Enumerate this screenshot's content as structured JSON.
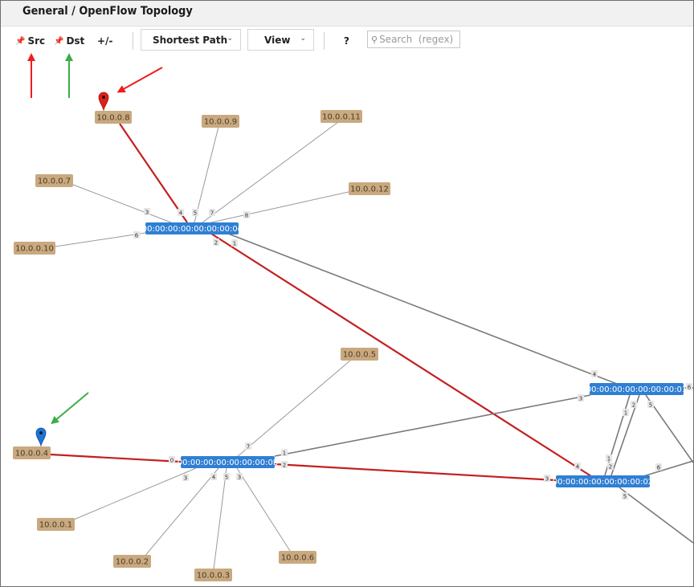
{
  "window": {
    "title": "General / OpenFlow Topology"
  },
  "toolbar": {
    "src_label": "Src",
    "dst_label": "Dst",
    "zoom_label": "+/-",
    "shortest_path_label": "Shortest Path",
    "view_label": "View",
    "help_label": "?",
    "search_placeholder": "Search  (regex)",
    "search_value": ""
  },
  "topology": {
    "switches": [
      {
        "id": "sw0c",
        "label": "00:00:00:00:00:00:00:0c"
      },
      {
        "id": "sw01",
        "label": "00:00:00:00:00:00:00:01"
      },
      {
        "id": "sw0b",
        "label": "00:00:00:00:00:00:00:0b"
      },
      {
        "id": "sw02",
        "label": "00:00:00:00:00:00:00:02"
      }
    ],
    "hosts": [
      {
        "id": "h8",
        "label": "10.0.0.8"
      },
      {
        "id": "h9",
        "label": "10.0.0.9"
      },
      {
        "id": "h11",
        "label": "10.0.0.11"
      },
      {
        "id": "h7",
        "label": "10.0.0.7"
      },
      {
        "id": "h12",
        "label": "10.0.0.12"
      },
      {
        "id": "h10",
        "label": "10.0.0.10"
      },
      {
        "id": "h5",
        "label": "10.0.0.5"
      },
      {
        "id": "h4",
        "label": "10.0.0.4"
      },
      {
        "id": "h1",
        "label": "10.0.0.1"
      },
      {
        "id": "h2",
        "label": "10.0.0.2"
      },
      {
        "id": "h3",
        "label": "10.0.0.3"
      },
      {
        "id": "h6",
        "label": "10.0.0.6"
      }
    ],
    "links": [
      {
        "from": "h8",
        "to": "sw0c",
        "port": "4",
        "path": true
      },
      {
        "from": "h9",
        "to": "sw0c",
        "port": "5",
        "path": false
      },
      {
        "from": "h11",
        "to": "sw0c",
        "port": "7",
        "path": false
      },
      {
        "from": "h7",
        "to": "sw0c",
        "port": "3",
        "path": false
      },
      {
        "from": "h12",
        "to": "sw0c",
        "port": "8",
        "path": false
      },
      {
        "from": "h10",
        "to": "sw0c",
        "port": "6",
        "path": false
      },
      {
        "from": "sw0c",
        "to": "sw02",
        "port": "2",
        "port2": "4",
        "path": true
      },
      {
        "from": "sw0c",
        "to": "sw01",
        "port": "1",
        "port2": "4",
        "path": false
      },
      {
        "from": "h5",
        "to": "sw0b",
        "port": "7",
        "path": false
      },
      {
        "from": "h4",
        "to": "sw0b",
        "port": "0",
        "path": true
      },
      {
        "from": "h1",
        "to": "sw0b",
        "port": "3",
        "path": false
      },
      {
        "from": "h2",
        "to": "sw0b",
        "port": "4",
        "path": false
      },
      {
        "from": "h3",
        "to": "sw0b",
        "port": "5",
        "path": false
      },
      {
        "from": "h6",
        "to": "sw0b",
        "port": "3",
        "path": false
      },
      {
        "from": "sw0b",
        "to": "sw01",
        "port": "1",
        "port2": "3",
        "path": false
      },
      {
        "from": "sw0b",
        "to": "sw02",
        "port": "2",
        "port2": "3",
        "path": true
      },
      {
        "from": "sw01",
        "to": "sw02",
        "port": "1",
        "port2": "2",
        "path": false
      },
      {
        "from": "sw01",
        "to": "sw02",
        "port": "2",
        "port2": "1",
        "path": false
      },
      {
        "from": "sw01",
        "to": "offscreen-a",
        "port": "5",
        "path": false
      },
      {
        "from": "sw01",
        "to": "offscreen-b",
        "port": "6",
        "path": false
      },
      {
        "from": "sw02",
        "to": "offscreen-c",
        "port": "6",
        "path": false
      },
      {
        "from": "sw02",
        "to": "offscreen-d",
        "port": "5",
        "path": false
      }
    ],
    "markers": [
      {
        "name": "src-pin-icon",
        "color": "#e0201b",
        "host": "h8"
      },
      {
        "name": "dst-pin-icon",
        "color": "#1f75d6",
        "host": "h4"
      }
    ]
  },
  "colors": {
    "path": "#c41f1f",
    "link": "#8a8a8a",
    "switch": "#2f7fd4",
    "host": "#c9a97f",
    "annotation_red": "#ee1c1c",
    "annotation_green": "#3aae49"
  }
}
